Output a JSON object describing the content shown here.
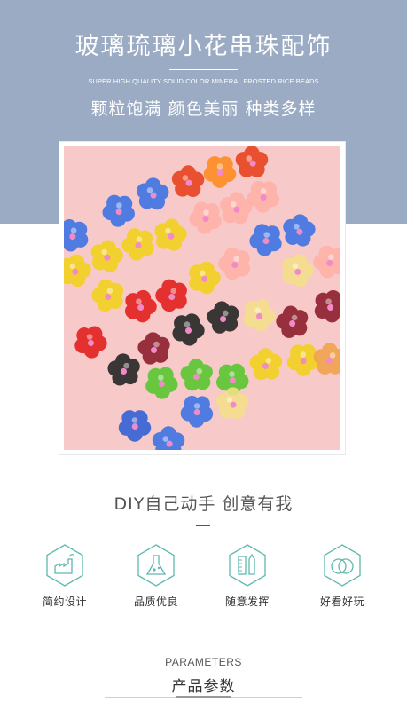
{
  "header": {
    "title": "玻璃琉璃小花串珠配饰",
    "subtitle_en": "SUPER HIGH QUALITY SOLID COLOR MINERAL FROSTED RICE BEADS",
    "tagline": "颗粒饱满 颜色美丽 种类多样"
  },
  "photo": {
    "background": "#f7c9c8",
    "bead_colors": [
      "#e8401c",
      "#ff8a1e",
      "#3a72e6",
      "#f2d21a",
      "#e21b1b",
      "#ffb0a8",
      "#55c72b",
      "#222222",
      "#8b1a2a",
      "#f4e08a",
      "#2f5fd6",
      "#f2a24a"
    ]
  },
  "section": {
    "heading": "DIY自己动手 创意有我"
  },
  "features": [
    {
      "icon": "factory-icon",
      "label": "简约设计"
    },
    {
      "icon": "flask-icon",
      "label": "品质优良"
    },
    {
      "icon": "ruler-pencil-icon",
      "label": "随意发挥"
    },
    {
      "icon": "rings-icon",
      "label": "好看好玩"
    }
  ],
  "params": {
    "en": "PARAMETERS",
    "cn": "产品参数"
  },
  "colors": {
    "hero_bg": "#9aabc3",
    "accent": "#5fb8b0"
  }
}
